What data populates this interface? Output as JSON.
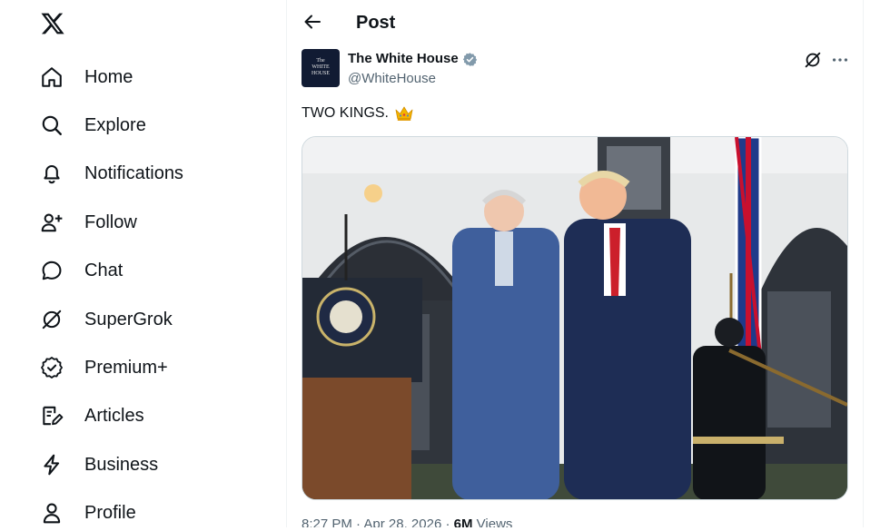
{
  "sidebar": {
    "logo": "x-logo-icon",
    "items": [
      {
        "label": "Home",
        "icon": "home-icon"
      },
      {
        "label": "Explore",
        "icon": "search-icon"
      },
      {
        "label": "Notifications",
        "icon": "bell-icon"
      },
      {
        "label": "Follow",
        "icon": "add-user-icon"
      },
      {
        "label": "Chat",
        "icon": "chat-bubble-icon"
      },
      {
        "label": "SuperGrok",
        "icon": "grok-icon"
      },
      {
        "label": "Premium+",
        "icon": "badge-check-icon"
      },
      {
        "label": "Articles",
        "icon": "article-edit-icon"
      },
      {
        "label": "Business",
        "icon": "lightning-icon"
      },
      {
        "label": "Profile",
        "icon": "person-icon"
      }
    ]
  },
  "header": {
    "title": "Post",
    "back_icon": "back-arrow-icon"
  },
  "post": {
    "author": {
      "name": "The White House",
      "handle": "@WhiteHouse",
      "avatar_text": "The\nWHITE\nHOUSE",
      "verified_color": "#829aab"
    },
    "text": "TWO KINGS.",
    "emoji": "crown-icon",
    "image_alt": "King Charles and Donald Trump standing together outdoors beside a podium with the presidential seal and a Union Jack flag",
    "time": "8:27 PM",
    "date": "Apr 28, 2026",
    "views_count": "6M",
    "views_label": "Views"
  },
  "colors": {
    "text": "#0f1419",
    "secondary_text": "#536471",
    "border": "#eff3f4"
  }
}
